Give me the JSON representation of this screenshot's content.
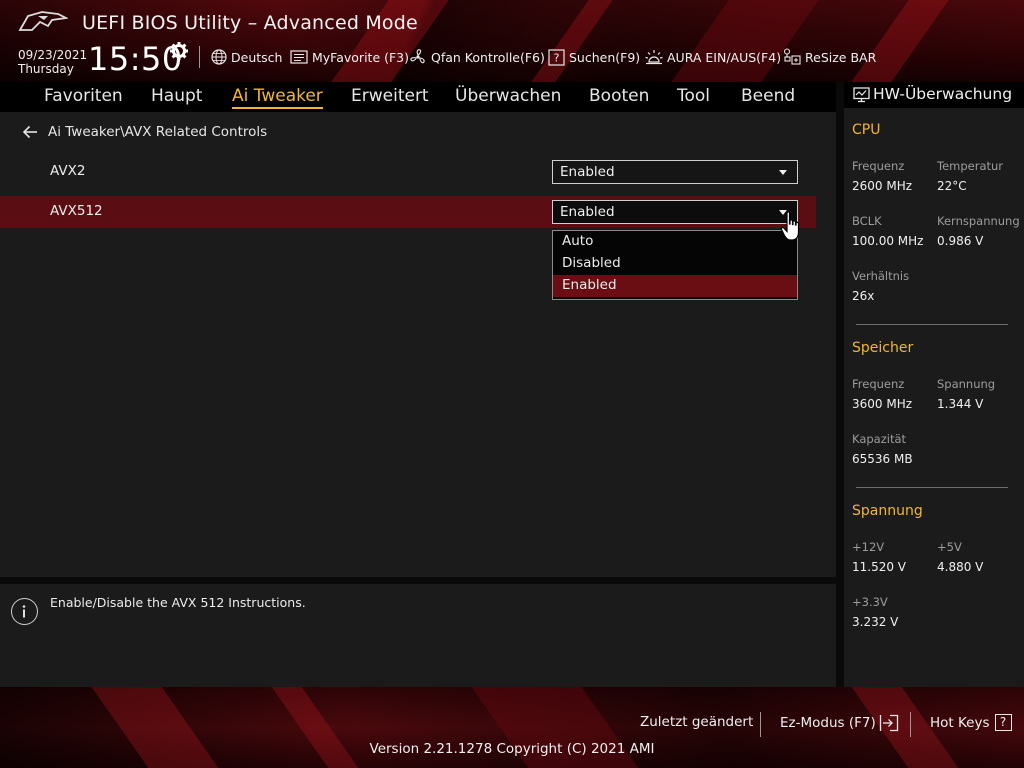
{
  "header": {
    "title": "UEFI BIOS Utility – Advanced Mode",
    "date": "09/23/2021",
    "day": "Thursday",
    "time": "15:50",
    "toolbar": {
      "language": "Deutsch",
      "myfavorite": "MyFavorite (F3)",
      "qfan": "Qfan Kontrolle(F6)",
      "search": "Suchen(F9)",
      "aura": "AURA EIN/AUS(F4)",
      "resize_bar": "ReSize BAR"
    }
  },
  "nav": {
    "tabs": [
      {
        "label": "Favoriten"
      },
      {
        "label": "Haupt"
      },
      {
        "label": "Ai Tweaker"
      },
      {
        "label": "Erweitert"
      },
      {
        "label": "Überwachen"
      },
      {
        "label": "Booten"
      },
      {
        "label": "Tool"
      },
      {
        "label": "Beend"
      }
    ],
    "active": "Ai Tweaker"
  },
  "main": {
    "breadcrumb": "Ai Tweaker\\AVX Related Controls",
    "settings": [
      {
        "label": "AVX2",
        "value": "Enabled"
      },
      {
        "label": "AVX512",
        "value": "Enabled"
      }
    ],
    "dropdown_options": [
      "Auto",
      "Disabled",
      "Enabled"
    ],
    "dropdown_selected": "Enabled"
  },
  "help": {
    "text": "Enable/Disable the AVX 512 Instructions."
  },
  "hw_monitor": {
    "title": "HW-Überwachung",
    "cpu": {
      "heading": "CPU",
      "freq_label": "Frequenz",
      "freq_value": "2600 MHz",
      "temp_label": "Temperatur",
      "temp_value": "22°C",
      "bclk_label": "BCLK",
      "bclk_value": "100.00 MHz",
      "core_v_label": "Kernspannung",
      "core_v_value": "0.986 V",
      "ratio_label": "Verhältnis",
      "ratio_value": "26x"
    },
    "memory": {
      "heading": "Speicher",
      "freq_label": "Frequenz",
      "freq_value": "3600 MHz",
      "volt_label": "Spannung",
      "volt_value": "1.344 V",
      "cap_label": "Kapazität",
      "cap_value": "65536 MB"
    },
    "voltage": {
      "heading": "Spannung",
      "v12_label": "+12V",
      "v12_value": "11.520 V",
      "v5_label": "+5V",
      "v5_value": "4.880 V",
      "v33_label": "+3.3V",
      "v33_value": "3.232 V"
    }
  },
  "footer": {
    "last_modified": "Zuletzt geändert",
    "ez_mode": "Ez-Modus (F7)",
    "hot_keys": "Hot Keys",
    "hot_keys_key": "?",
    "version": "Version 2.21.1278 Copyright (C) 2021 AMI"
  },
  "colors": {
    "accent": "#f2b632",
    "selected_row": "#5a0d12",
    "panel": "#1b1b1b"
  }
}
